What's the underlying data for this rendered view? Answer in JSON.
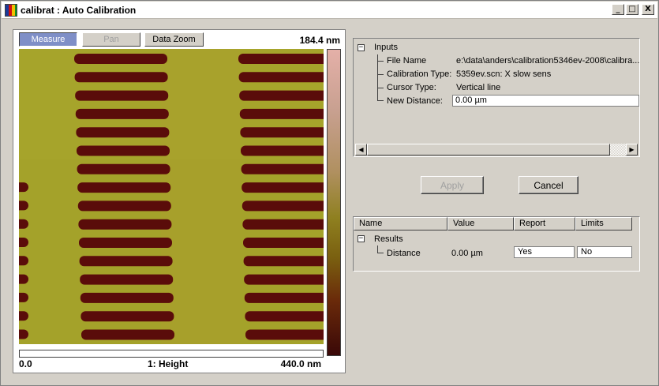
{
  "window": {
    "title": "calibrat : Auto Calibration",
    "buttons": {
      "minimize": "_",
      "maximize": "□",
      "close": "X"
    }
  },
  "image_panel": {
    "toolbar": {
      "measure": "Measure",
      "pan": "Pan",
      "data_zoom": "Data Zoom"
    },
    "scale_max": "184.4 nm",
    "axis_min": "0.0",
    "axis_title": "1: Height",
    "axis_max": "440.0 nm",
    "colors": {
      "background": "#a4a22a",
      "stripe": "#5a0c0a",
      "colorbar_top": "#e4b0a8",
      "colorbar_bottom": "#3a0808"
    }
  },
  "inputs": {
    "expander": "⊟",
    "header": "Inputs",
    "rows": [
      {
        "label": "File Name",
        "value": "e:\\data\\anders\\calibration5346ev-2008\\calibra..."
      },
      {
        "label": "Calibration Type:",
        "value": "5359ev.scn: X slow sens"
      },
      {
        "label": "Cursor Type:",
        "value": "Vertical line"
      },
      {
        "label": "New Distance:",
        "value": "0.00 µm"
      }
    ],
    "scroll_left": "◀",
    "scroll_right": "▶"
  },
  "actions": {
    "apply": "Apply",
    "cancel": "Cancel"
  },
  "results": {
    "columns": [
      "Name",
      "Value",
      "Report",
      "Limits"
    ],
    "expander": "⊟",
    "header": "Results",
    "row": {
      "name": "Distance",
      "value": "0.00 µm",
      "report": "Yes",
      "limits": "No"
    }
  }
}
